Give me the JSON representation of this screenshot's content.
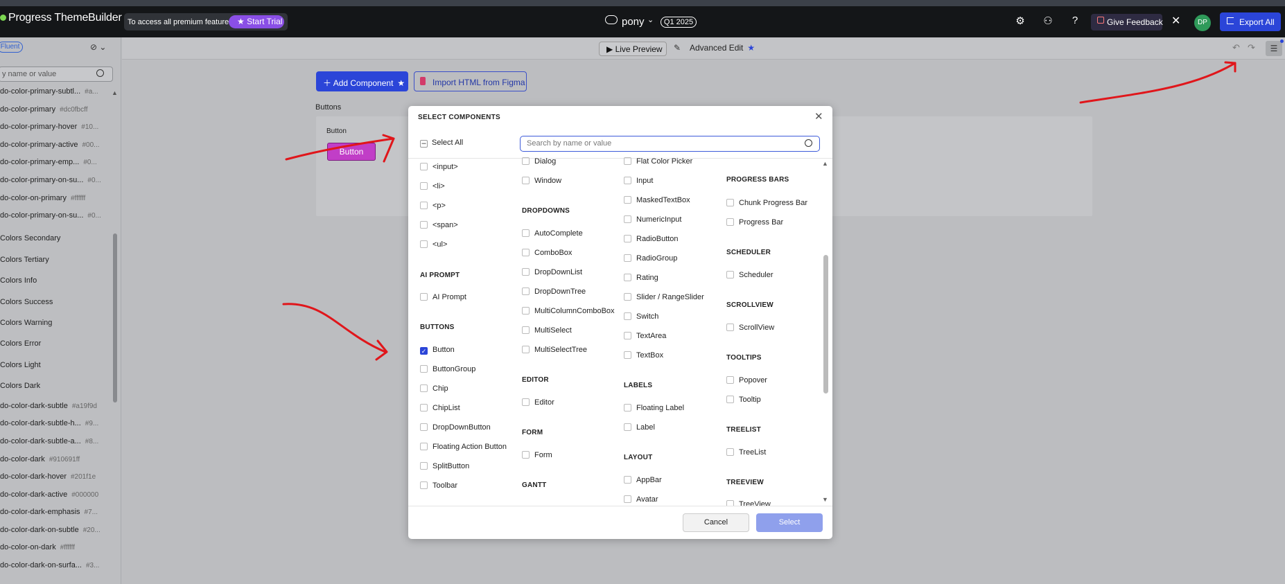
{
  "header": {
    "logo": "Progress ThemeBuilder",
    "premium_text": "To access all premium features",
    "trial_label": "Start Trial",
    "project_name": "pony",
    "version_badge": "Q1 2025",
    "feedback_label": "Give Feedback",
    "avatar_initials": "DP",
    "export_label": "Export All"
  },
  "sidebar": {
    "theme_badge": "Fluent",
    "search_placeholder": "y name or value",
    "tokens": [
      {
        "name": "do-color-primary-subtl...",
        "value": "#a..."
      },
      {
        "name": "do-color-primary",
        "value": "#dc0fbcff"
      },
      {
        "name": "do-color-primary-hover",
        "value": "#10..."
      },
      {
        "name": "do-color-primary-active",
        "value": "#00..."
      },
      {
        "name": "do-color-primary-emp...",
        "value": "#0..."
      },
      {
        "name": "do-color-primary-on-su...",
        "value": "#0..."
      },
      {
        "name": "do-color-on-primary",
        "value": "#ffffff"
      },
      {
        "name": "do-color-primary-on-su...",
        "value": "#0..."
      }
    ],
    "groups": [
      "Colors Secondary",
      "Colors Tertiary",
      "Colors Info",
      "Colors Success",
      "Colors Warning",
      "Colors Error",
      "Colors Light",
      "Colors Dark"
    ],
    "dark_tokens": [
      {
        "name": "do-color-dark-subtle",
        "value": "#a19f9d"
      },
      {
        "name": "do-color-dark-subtle-h...",
        "value": "#9..."
      },
      {
        "name": "do-color-dark-subtle-a...",
        "value": "#8..."
      },
      {
        "name": "do-color-dark",
        "value": "#910691ff"
      },
      {
        "name": "do-color-dark-hover",
        "value": "#201f1e"
      },
      {
        "name": "do-color-dark-active",
        "value": "#000000"
      },
      {
        "name": "do-color-dark-emphasis",
        "value": "#7..."
      },
      {
        "name": "do-color-dark-on-subtle",
        "value": "#20..."
      },
      {
        "name": "do-color-on-dark",
        "value": "#ffffff"
      },
      {
        "name": "do-color-dark-on-surfa...",
        "value": "#3..."
      }
    ]
  },
  "toolbar": {
    "live_preview": "Live Preview",
    "advanced_edit": "Advanced Edit"
  },
  "canvas": {
    "add_component": "Add Component",
    "import_html": "Import HTML from Figma",
    "section_title": "Buttons",
    "card_label": "Button",
    "sample_button": "Button"
  },
  "modal": {
    "title": "SELECT COMPONENTS",
    "select_all": "Select All",
    "search_placeholder": "Search by name or value",
    "cancel": "Cancel",
    "select": "Select",
    "col1": {
      "items_top": [
        "<input>",
        "<li>",
        "<p>",
        "<span>",
        "<ul>"
      ],
      "cat_ai": "AI PROMPT",
      "ai_items": [
        "AI Prompt"
      ],
      "cat_buttons": "BUTTONS",
      "button_items": [
        "Button",
        "ButtonGroup",
        "Chip",
        "ChipList",
        "DropDownButton",
        "Floating Action Button",
        "SplitButton",
        "Toolbar"
      ]
    },
    "col2": {
      "items_top": [
        "Dialog",
        "Window"
      ],
      "cat_dropdowns": "DROPDOWNS",
      "dropdown_items": [
        "AutoComplete",
        "ComboBox",
        "DropDownList",
        "DropDownTree",
        "MultiColumnComboBox",
        "MultiSelect",
        "MultiSelectTree"
      ],
      "cat_editor": "EDITOR",
      "editor_items": [
        "Editor"
      ],
      "cat_form": "FORM",
      "form_items": [
        "Form"
      ],
      "cat_gantt": "GANTT"
    },
    "col3": {
      "items_top": [
        "Flat Color Picker",
        "Input",
        "MaskedTextBox",
        "NumericInput",
        "RadioButton",
        "RadioGroup",
        "Rating",
        "Slider / RangeSlider",
        "Switch",
        "TextArea",
        "TextBox"
      ],
      "cat_labels": "LABELS",
      "label_items": [
        "Floating Label",
        "Label"
      ],
      "cat_layout": "LAYOUT",
      "layout_items": [
        "AppBar",
        "Avatar"
      ]
    },
    "col4": {
      "cat_progress": "PROGRESS BARS",
      "progress_items": [
        "Chunk Progress Bar",
        "Progress Bar"
      ],
      "cat_scheduler": "SCHEDULER",
      "scheduler_items": [
        "Scheduler"
      ],
      "cat_scrollview": "SCROLLVIEW",
      "scrollview_items": [
        "ScrollView"
      ],
      "cat_tooltips": "TOOLTIPS",
      "tooltip_items": [
        "Popover",
        "Tooltip"
      ],
      "cat_treelist": "TREELIST",
      "treelist_items": [
        "TreeList"
      ],
      "cat_treeview": "TREEVIEW",
      "treeview_items": [
        "TreeView"
      ]
    }
  },
  "colors": {
    "accent": "#2b45d8",
    "annotation": "#e0161b",
    "sample_button": "#c13ec7"
  }
}
